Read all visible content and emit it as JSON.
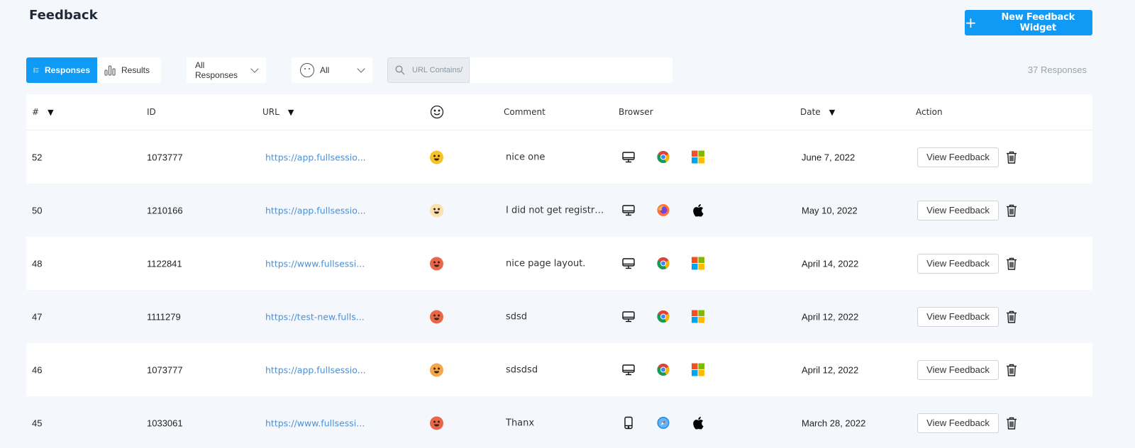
{
  "header": {
    "title": "Feedback",
    "new_button_label": "New Feedback Widget"
  },
  "toolbar": {
    "view_tabs": [
      {
        "label": "Responses",
        "active": true
      },
      {
        "label": "Results",
        "active": false
      }
    ],
    "response_filter": "All Responses",
    "mood_filter": "All",
    "search": {
      "prefix": "URL Contains/",
      "value": ""
    },
    "response_count": "37 Responses"
  },
  "columns": [
    "#",
    "ID",
    "URL",
    "Comment",
    "Browser",
    "Date",
    "Action"
  ],
  "colors": {
    "accent": "#0e9af5",
    "link": "#4b90d6",
    "happy": "#f6c229",
    "neutral_pale": "#fadfb0",
    "angry": "#e8674a",
    "meh": "#f4a74a"
  },
  "rows": [
    {
      "num": "52",
      "id": "1073777",
      "url": "https://app.fullsessio...",
      "mood": "happy",
      "comment": "nice one",
      "device": "desktop-icon",
      "browser": "chrome-icon",
      "os": "windows-icon",
      "date": "June 7, 2022",
      "action": "View Feedback"
    },
    {
      "num": "50",
      "id": "1210166",
      "url": "https://app.fullsessio...",
      "mood": "neutral_pale",
      "comment": "I did not get registrat...",
      "device": "desktop-icon",
      "browser": "firefox-icon",
      "os": "apple-icon",
      "date": "May 10, 2022",
      "action": "View Feedback"
    },
    {
      "num": "48",
      "id": "1122841",
      "url": "https://www.fullsessi...",
      "mood": "angry",
      "comment": "nice page layout.",
      "device": "desktop-icon",
      "browser": "chrome-icon",
      "os": "windows-icon",
      "date": "April 14, 2022",
      "action": "View Feedback"
    },
    {
      "num": "47",
      "id": "1111279",
      "url": "https://test-new.fulls...",
      "mood": "angry",
      "comment": "sdsd",
      "device": "desktop-icon",
      "browser": "chrome-icon",
      "os": "windows-icon",
      "date": "April 12, 2022",
      "action": "View Feedback"
    },
    {
      "num": "46",
      "id": "1073777",
      "url": "https://app.fullsessio...",
      "mood": "meh",
      "comment": "sdsdsd",
      "device": "desktop-icon",
      "browser": "chrome-icon",
      "os": "windows-icon",
      "date": "April 12, 2022",
      "action": "View Feedback"
    },
    {
      "num": "45",
      "id": "1033061",
      "url": "https://www.fullsessi...",
      "mood": "angry",
      "comment": "Thanx",
      "device": "mobile-icon",
      "browser": "safari-icon",
      "os": "apple-icon",
      "date": "March 28, 2022",
      "action": "View Feedback"
    }
  ]
}
